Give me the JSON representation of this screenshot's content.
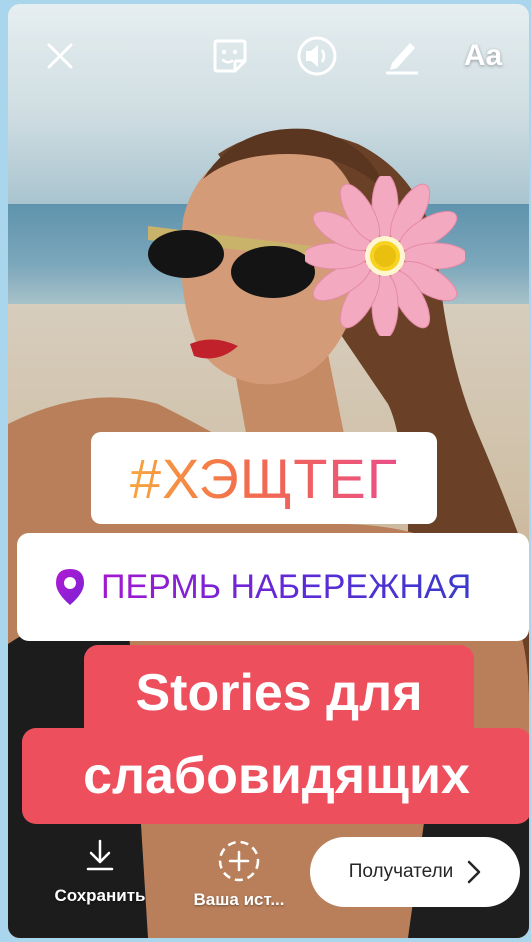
{
  "toolbar": {
    "close_icon": "close-icon",
    "sticker_icon": "sticker-icon",
    "sound_icon": "sound-icon",
    "draw_icon": "pen-icon",
    "text_label": "Aa"
  },
  "stickers": {
    "hashtag": "#ХЭЩТЕГ",
    "location": "ПЕРМЬ НАБЕРЕЖНАЯ",
    "caption_lines": [
      "Stories для",
      "слабовидящих"
    ]
  },
  "bottom_bar": {
    "save_label": "Сохранить",
    "your_story_label": "Ваша ист...",
    "recipients_label": "Получатели"
  },
  "colors": {
    "caption_bg": "#ee4f5d",
    "frame_bg": "#a9d6ec"
  }
}
